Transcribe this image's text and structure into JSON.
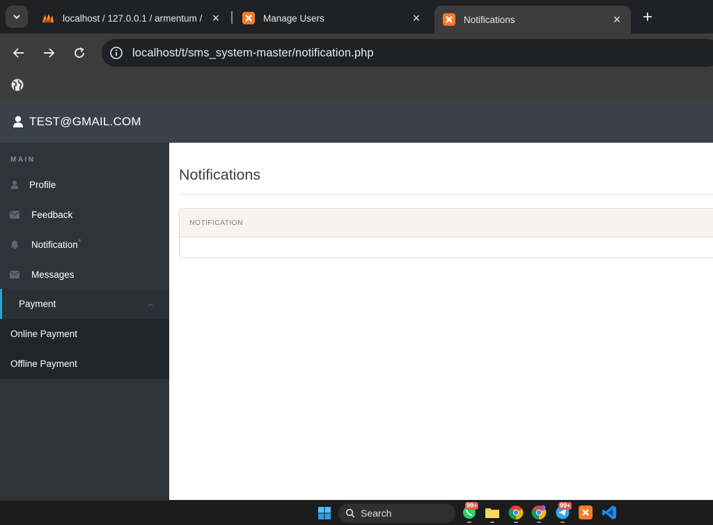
{
  "browser": {
    "tabs": [
      {
        "title": "localhost / 127.0.0.1 / armentum /",
        "icon": "phpmyadmin-icon",
        "active": false
      },
      {
        "title": "Manage Users",
        "icon": "xampp-icon",
        "active": false
      },
      {
        "title": "Notifications",
        "icon": "xampp-icon",
        "active": true
      }
    ],
    "url": "localhost/t/sms_system-master/notification.php"
  },
  "header": {
    "user_email": "TEST@GMAIL.COM"
  },
  "sidebar": {
    "heading": "MAIN",
    "items": [
      {
        "label": "Profile",
        "icon": "user-icon"
      },
      {
        "label": "Feedback",
        "icon": "envelope-icon"
      },
      {
        "label": "Notification",
        "icon": "bell-icon",
        "badge": "*"
      },
      {
        "label": "Messages",
        "icon": "envelope-icon"
      },
      {
        "label": "Payment",
        "icon": "chevron-up-icon",
        "expanded": true
      }
    ],
    "sub_items": [
      {
        "label": "Online Payment"
      },
      {
        "label": "Offline Payment"
      }
    ]
  },
  "main": {
    "title": "Notifications",
    "table": {
      "column_header": "NOTIFICATION",
      "rows": []
    }
  },
  "taskbar": {
    "search_label": "Search",
    "badges": [
      "99+",
      "99+"
    ]
  },
  "colors": {
    "accent": "#20a8d8",
    "topbar": "#3a4149",
    "sidebar": "#2e343a",
    "badge": "#f86c6b"
  }
}
